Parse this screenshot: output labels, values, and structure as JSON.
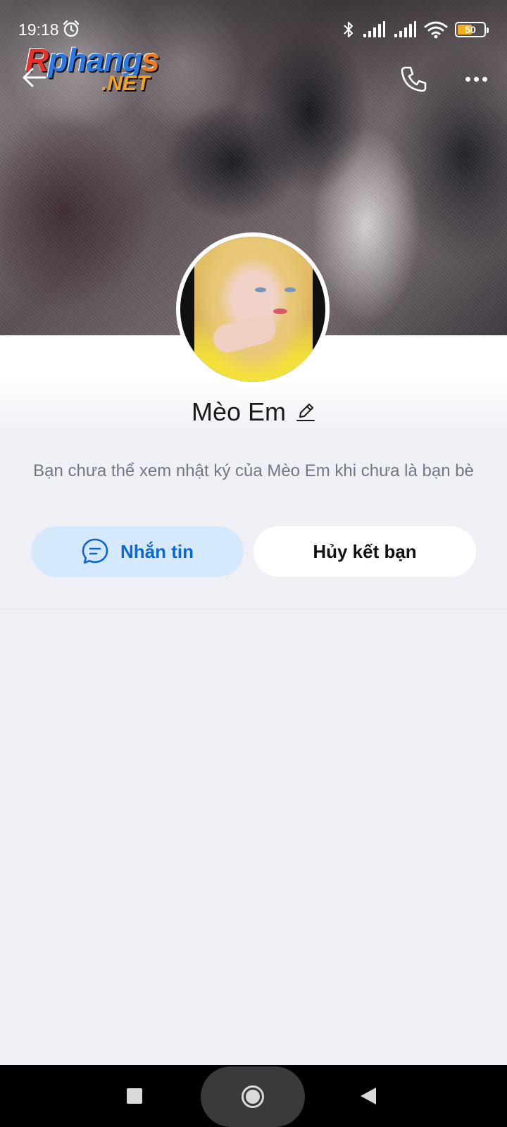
{
  "status_bar": {
    "time": "19:18",
    "battery_level": "50",
    "icons": [
      "alarm-icon",
      "bluetooth-icon",
      "signal-icon",
      "signal-icon",
      "wifi-icon",
      "battery-icon"
    ]
  },
  "watermark": {
    "line1_r": "R",
    "line1_main": "phang",
    "line1_s": "s",
    "line2": ".NET"
  },
  "header": {
    "icons": [
      "back-arrow-icon",
      "phone-icon",
      "more-icon"
    ]
  },
  "profile": {
    "name": "Mèo Em",
    "notice": "Bạn chưa thể xem nhật ký của Mèo Em khi chưa là bạn bè"
  },
  "actions": {
    "message_label": "Nhắn tin",
    "unfriend_label": "Hủy kết bạn"
  },
  "colors": {
    "accent": "#0a68d1",
    "message_button_bg": "#d6e8fc",
    "page_bg": "#eef0f5",
    "notice_text": "#707783"
  }
}
